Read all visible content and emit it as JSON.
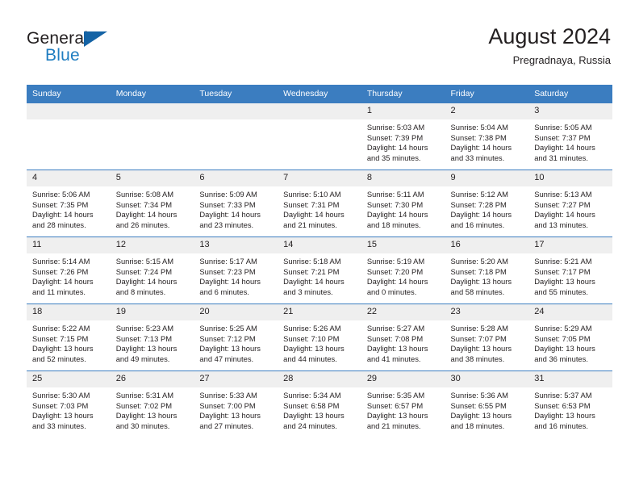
{
  "brand": {
    "line1": "General",
    "line2": "Blue",
    "flag_icon": "triangle-flag-icon",
    "accent_color": "#1f7dc0"
  },
  "header": {
    "title": "August 2024",
    "subtitle": "Pregradnaya, Russia"
  },
  "theme": {
    "header_row_bg": "#3b7dc0",
    "daynum_bg": "#efefef",
    "border_color": "#3b7dc0",
    "text_color": "#231f20"
  },
  "weekdays": [
    "Sunday",
    "Monday",
    "Tuesday",
    "Wednesday",
    "Thursday",
    "Friday",
    "Saturday"
  ],
  "weeks": [
    [
      {
        "day": "",
        "empty": true,
        "sunrise": "",
        "sunset": "",
        "daylight1": "",
        "daylight2": ""
      },
      {
        "day": "",
        "empty": true,
        "sunrise": "",
        "sunset": "",
        "daylight1": "",
        "daylight2": ""
      },
      {
        "day": "",
        "empty": true,
        "sunrise": "",
        "sunset": "",
        "daylight1": "",
        "daylight2": ""
      },
      {
        "day": "",
        "empty": true,
        "sunrise": "",
        "sunset": "",
        "daylight1": "",
        "daylight2": ""
      },
      {
        "day": "1",
        "empty": false,
        "sunrise": "Sunrise: 5:03 AM",
        "sunset": "Sunset: 7:39 PM",
        "daylight1": "Daylight: 14 hours",
        "daylight2": "and 35 minutes."
      },
      {
        "day": "2",
        "empty": false,
        "sunrise": "Sunrise: 5:04 AM",
        "sunset": "Sunset: 7:38 PM",
        "daylight1": "Daylight: 14 hours",
        "daylight2": "and 33 minutes."
      },
      {
        "day": "3",
        "empty": false,
        "sunrise": "Sunrise: 5:05 AM",
        "sunset": "Sunset: 7:37 PM",
        "daylight1": "Daylight: 14 hours",
        "daylight2": "and 31 minutes."
      }
    ],
    [
      {
        "day": "4",
        "empty": false,
        "sunrise": "Sunrise: 5:06 AM",
        "sunset": "Sunset: 7:35 PM",
        "daylight1": "Daylight: 14 hours",
        "daylight2": "and 28 minutes."
      },
      {
        "day": "5",
        "empty": false,
        "sunrise": "Sunrise: 5:08 AM",
        "sunset": "Sunset: 7:34 PM",
        "daylight1": "Daylight: 14 hours",
        "daylight2": "and 26 minutes."
      },
      {
        "day": "6",
        "empty": false,
        "sunrise": "Sunrise: 5:09 AM",
        "sunset": "Sunset: 7:33 PM",
        "daylight1": "Daylight: 14 hours",
        "daylight2": "and 23 minutes."
      },
      {
        "day": "7",
        "empty": false,
        "sunrise": "Sunrise: 5:10 AM",
        "sunset": "Sunset: 7:31 PM",
        "daylight1": "Daylight: 14 hours",
        "daylight2": "and 21 minutes."
      },
      {
        "day": "8",
        "empty": false,
        "sunrise": "Sunrise: 5:11 AM",
        "sunset": "Sunset: 7:30 PM",
        "daylight1": "Daylight: 14 hours",
        "daylight2": "and 18 minutes."
      },
      {
        "day": "9",
        "empty": false,
        "sunrise": "Sunrise: 5:12 AM",
        "sunset": "Sunset: 7:28 PM",
        "daylight1": "Daylight: 14 hours",
        "daylight2": "and 16 minutes."
      },
      {
        "day": "10",
        "empty": false,
        "sunrise": "Sunrise: 5:13 AM",
        "sunset": "Sunset: 7:27 PM",
        "daylight1": "Daylight: 14 hours",
        "daylight2": "and 13 minutes."
      }
    ],
    [
      {
        "day": "11",
        "empty": false,
        "sunrise": "Sunrise: 5:14 AM",
        "sunset": "Sunset: 7:26 PM",
        "daylight1": "Daylight: 14 hours",
        "daylight2": "and 11 minutes."
      },
      {
        "day": "12",
        "empty": false,
        "sunrise": "Sunrise: 5:15 AM",
        "sunset": "Sunset: 7:24 PM",
        "daylight1": "Daylight: 14 hours",
        "daylight2": "and 8 minutes."
      },
      {
        "day": "13",
        "empty": false,
        "sunrise": "Sunrise: 5:17 AM",
        "sunset": "Sunset: 7:23 PM",
        "daylight1": "Daylight: 14 hours",
        "daylight2": "and 6 minutes."
      },
      {
        "day": "14",
        "empty": false,
        "sunrise": "Sunrise: 5:18 AM",
        "sunset": "Sunset: 7:21 PM",
        "daylight1": "Daylight: 14 hours",
        "daylight2": "and 3 minutes."
      },
      {
        "day": "15",
        "empty": false,
        "sunrise": "Sunrise: 5:19 AM",
        "sunset": "Sunset: 7:20 PM",
        "daylight1": "Daylight: 14 hours",
        "daylight2": "and 0 minutes."
      },
      {
        "day": "16",
        "empty": false,
        "sunrise": "Sunrise: 5:20 AM",
        "sunset": "Sunset: 7:18 PM",
        "daylight1": "Daylight: 13 hours",
        "daylight2": "and 58 minutes."
      },
      {
        "day": "17",
        "empty": false,
        "sunrise": "Sunrise: 5:21 AM",
        "sunset": "Sunset: 7:17 PM",
        "daylight1": "Daylight: 13 hours",
        "daylight2": "and 55 minutes."
      }
    ],
    [
      {
        "day": "18",
        "empty": false,
        "sunrise": "Sunrise: 5:22 AM",
        "sunset": "Sunset: 7:15 PM",
        "daylight1": "Daylight: 13 hours",
        "daylight2": "and 52 minutes."
      },
      {
        "day": "19",
        "empty": false,
        "sunrise": "Sunrise: 5:23 AM",
        "sunset": "Sunset: 7:13 PM",
        "daylight1": "Daylight: 13 hours",
        "daylight2": "and 49 minutes."
      },
      {
        "day": "20",
        "empty": false,
        "sunrise": "Sunrise: 5:25 AM",
        "sunset": "Sunset: 7:12 PM",
        "daylight1": "Daylight: 13 hours",
        "daylight2": "and 47 minutes."
      },
      {
        "day": "21",
        "empty": false,
        "sunrise": "Sunrise: 5:26 AM",
        "sunset": "Sunset: 7:10 PM",
        "daylight1": "Daylight: 13 hours",
        "daylight2": "and 44 minutes."
      },
      {
        "day": "22",
        "empty": false,
        "sunrise": "Sunrise: 5:27 AM",
        "sunset": "Sunset: 7:08 PM",
        "daylight1": "Daylight: 13 hours",
        "daylight2": "and 41 minutes."
      },
      {
        "day": "23",
        "empty": false,
        "sunrise": "Sunrise: 5:28 AM",
        "sunset": "Sunset: 7:07 PM",
        "daylight1": "Daylight: 13 hours",
        "daylight2": "and 38 minutes."
      },
      {
        "day": "24",
        "empty": false,
        "sunrise": "Sunrise: 5:29 AM",
        "sunset": "Sunset: 7:05 PM",
        "daylight1": "Daylight: 13 hours",
        "daylight2": "and 36 minutes."
      }
    ],
    [
      {
        "day": "25",
        "empty": false,
        "sunrise": "Sunrise: 5:30 AM",
        "sunset": "Sunset: 7:03 PM",
        "daylight1": "Daylight: 13 hours",
        "daylight2": "and 33 minutes."
      },
      {
        "day": "26",
        "empty": false,
        "sunrise": "Sunrise: 5:31 AM",
        "sunset": "Sunset: 7:02 PM",
        "daylight1": "Daylight: 13 hours",
        "daylight2": "and 30 minutes."
      },
      {
        "day": "27",
        "empty": false,
        "sunrise": "Sunrise: 5:33 AM",
        "sunset": "Sunset: 7:00 PM",
        "daylight1": "Daylight: 13 hours",
        "daylight2": "and 27 minutes."
      },
      {
        "day": "28",
        "empty": false,
        "sunrise": "Sunrise: 5:34 AM",
        "sunset": "Sunset: 6:58 PM",
        "daylight1": "Daylight: 13 hours",
        "daylight2": "and 24 minutes."
      },
      {
        "day": "29",
        "empty": false,
        "sunrise": "Sunrise: 5:35 AM",
        "sunset": "Sunset: 6:57 PM",
        "daylight1": "Daylight: 13 hours",
        "daylight2": "and 21 minutes."
      },
      {
        "day": "30",
        "empty": false,
        "sunrise": "Sunrise: 5:36 AM",
        "sunset": "Sunset: 6:55 PM",
        "daylight1": "Daylight: 13 hours",
        "daylight2": "and 18 minutes."
      },
      {
        "day": "31",
        "empty": false,
        "sunrise": "Sunrise: 5:37 AM",
        "sunset": "Sunset: 6:53 PM",
        "daylight1": "Daylight: 13 hours",
        "daylight2": "and 16 minutes."
      }
    ]
  ]
}
